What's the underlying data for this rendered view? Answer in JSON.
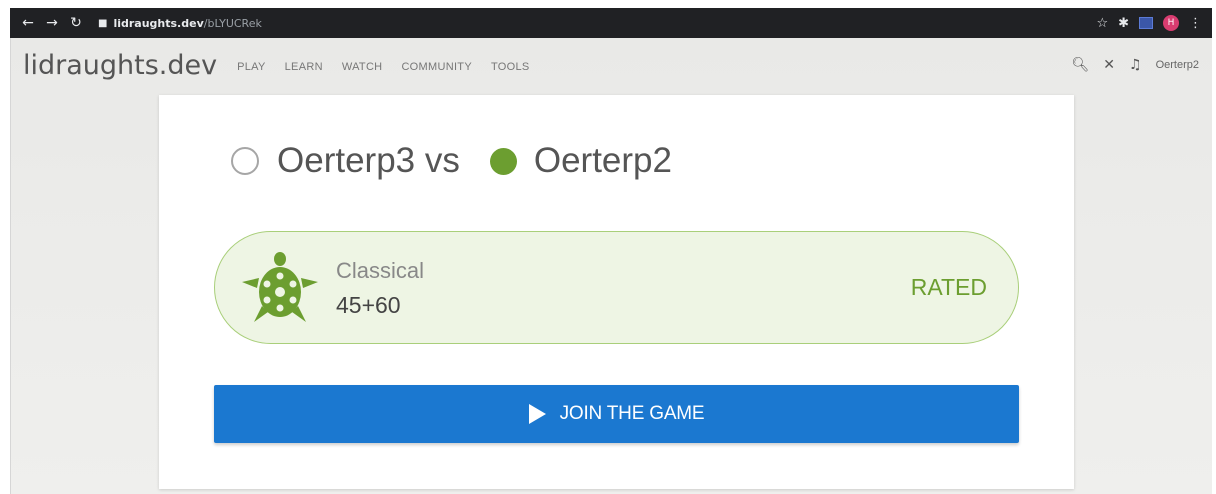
{
  "browser": {
    "url_host": "lidraughts.dev",
    "url_path": "/bLYUCRek",
    "profile_initial": "H"
  },
  "site": {
    "logo": "lidraughts.dev",
    "nav": [
      "PLAY",
      "LEARN",
      "WATCH",
      "COMMUNITY",
      "TOOLS"
    ],
    "username": "Oerterp2"
  },
  "challenge": {
    "player_white": "Oerterp3 vs",
    "player_black": "Oerterp2",
    "speed": "Classical",
    "clock": "45+60",
    "mode": "RATED",
    "join_label": "JOIN THE GAME"
  },
  "colors": {
    "accent_green": "#6c9e30",
    "join_blue": "#1b78d0"
  }
}
